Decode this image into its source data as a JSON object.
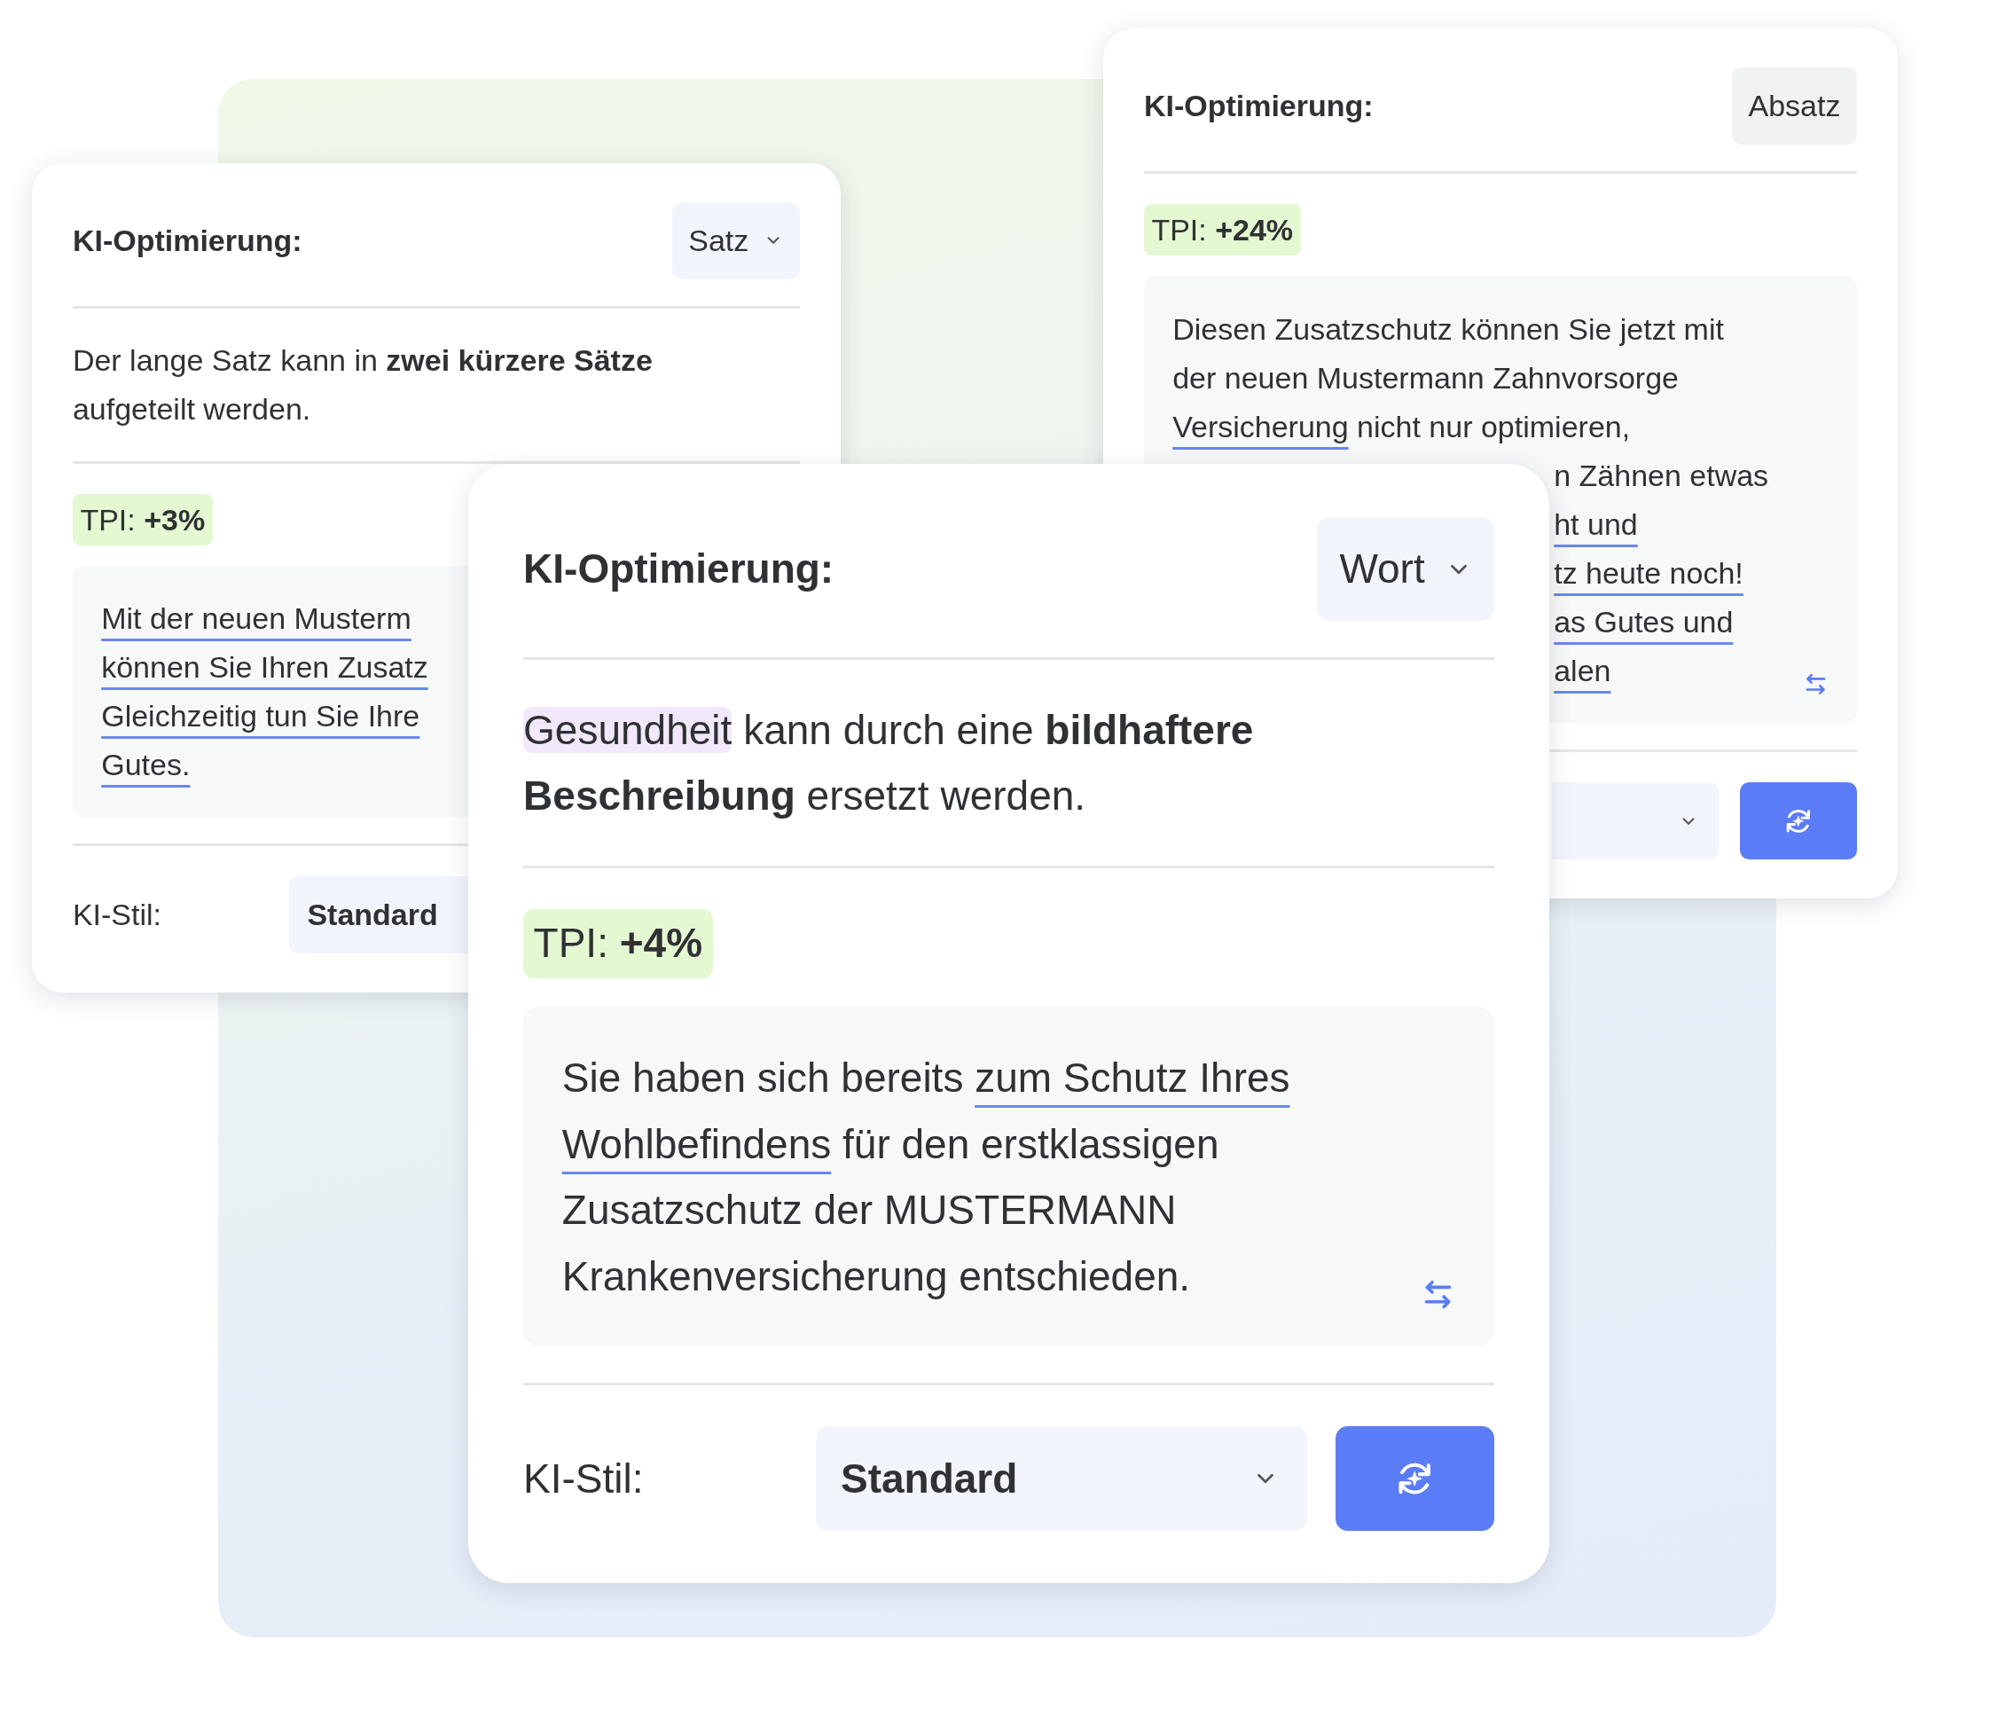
{
  "cards": [
    {
      "title": "KI-Optimierung:",
      "mode": {
        "value": "Satz",
        "expandable": true
      },
      "description": [
        {
          "segments": [
            {
              "text": "Der lange Satz kann in ",
              "kind": "plain"
            },
            {
              "text": "zwei kürzere Sätze",
              "kind": "bold"
            }
          ]
        },
        {
          "segments": [
            {
              "text": "aufgeteilt werden.",
              "kind": "plain"
            }
          ]
        }
      ],
      "tpi": "TPI: **+3%**",
      "body": [
        {
          "kind": "full",
          "segments": [
            {
              "text": "Mit der neuen Musterm",
              "kind": "underline"
            }
          ]
        },
        {
          "kind": "full",
          "segments": [
            {
              "text": "können Sie Ihren Zusatz",
              "kind": "underline"
            }
          ]
        },
        {
          "kind": "full",
          "segments": [
            {
              "text": "Gleichzeitig tun Sie Ihre",
              "kind": "underline"
            }
          ]
        },
        {
          "kind": "full",
          "segments": [
            {
              "text": "Gutes.",
              "kind": "underline"
            }
          ]
        }
      ],
      "footer": {
        "label": "KI-Stil:",
        "value": "Standard"
      }
    },
    {
      "title": "KI-Optimierung:",
      "mode": {
        "value": "Absatz",
        "expandable": false
      },
      "tpi": "TPI: **+24%**",
      "body": [
        {
          "kind": "full",
          "segments": [
            {
              "text": "Diesen Zusatzschutz können Sie jetzt mit",
              "kind": "plain"
            }
          ]
        },
        {
          "kind": "full",
          "segments": [
            {
              "text": "der neuen Mustermann Zahnvorsorge",
              "kind": "plain"
            }
          ]
        },
        {
          "kind": "full",
          "segments": [
            {
              "text": "Versicherung",
              "kind": "underline"
            },
            {
              "text": " nicht nur optimieren,",
              "kind": "plain"
            }
          ]
        },
        {
          "kind": "cut",
          "segments": [
            {
              "text": "n Zähnen etwas",
              "kind": "plain"
            }
          ]
        },
        {
          "kind": "cut",
          "segments": [
            {
              "text": "ht und",
              "kind": "underline"
            }
          ]
        },
        {
          "kind": "cut",
          "segments": [
            {
              "text": "tz heute noch!",
              "kind": "underline"
            }
          ]
        },
        {
          "kind": "cut",
          "segments": [
            {
              "text": "as Gutes und",
              "kind": "underline"
            }
          ]
        },
        {
          "kind": "cut",
          "segments": [
            {
              "text": "alen",
              "kind": "underline"
            }
          ]
        }
      ],
      "swap_button": true,
      "footer": {
        "chevron": true,
        "refresh_button": true
      }
    },
    {
      "title": "KI-Optimierung:",
      "mode": {
        "value": "Wort",
        "expandable": true
      },
      "description": [
        {
          "segments": [
            {
              "text": "Gesundheit",
              "kind": "highlight"
            },
            {
              "text": " kann durch eine ",
              "kind": "plain"
            },
            {
              "text": "bildhaftere",
              "kind": "bold"
            }
          ]
        },
        {
          "segments": [
            {
              "text": "Beschreibung",
              "kind": "bold"
            },
            {
              "text": " ersetzt werden.",
              "kind": "plain"
            }
          ]
        }
      ],
      "tpi": "TPI: **+4%**",
      "body": [
        {
          "kind": "full",
          "segments": [
            {
              "text": "Sie haben sich bereits ",
              "kind": "plain"
            },
            {
              "text": "zum Schutz Ihres",
              "kind": "underline"
            }
          ]
        },
        {
          "kind": "full",
          "segments": [
            {
              "text": "Wohlbefindens",
              "kind": "underline"
            },
            {
              "text": " für den erstklassigen",
              "kind": "plain"
            }
          ]
        },
        {
          "kind": "full",
          "segments": [
            {
              "text": "Zusatzschutz der MUSTERMANN",
              "kind": "plain"
            }
          ]
        },
        {
          "kind": "full",
          "segments": [
            {
              "text": "Krankenversicherung entschieden.",
              "kind": "plain"
            }
          ]
        }
      ],
      "swap_button": true,
      "footer": {
        "label": "KI-Stil:",
        "value": "Standard",
        "chevron": true,
        "refresh_button": true
      }
    }
  ]
}
